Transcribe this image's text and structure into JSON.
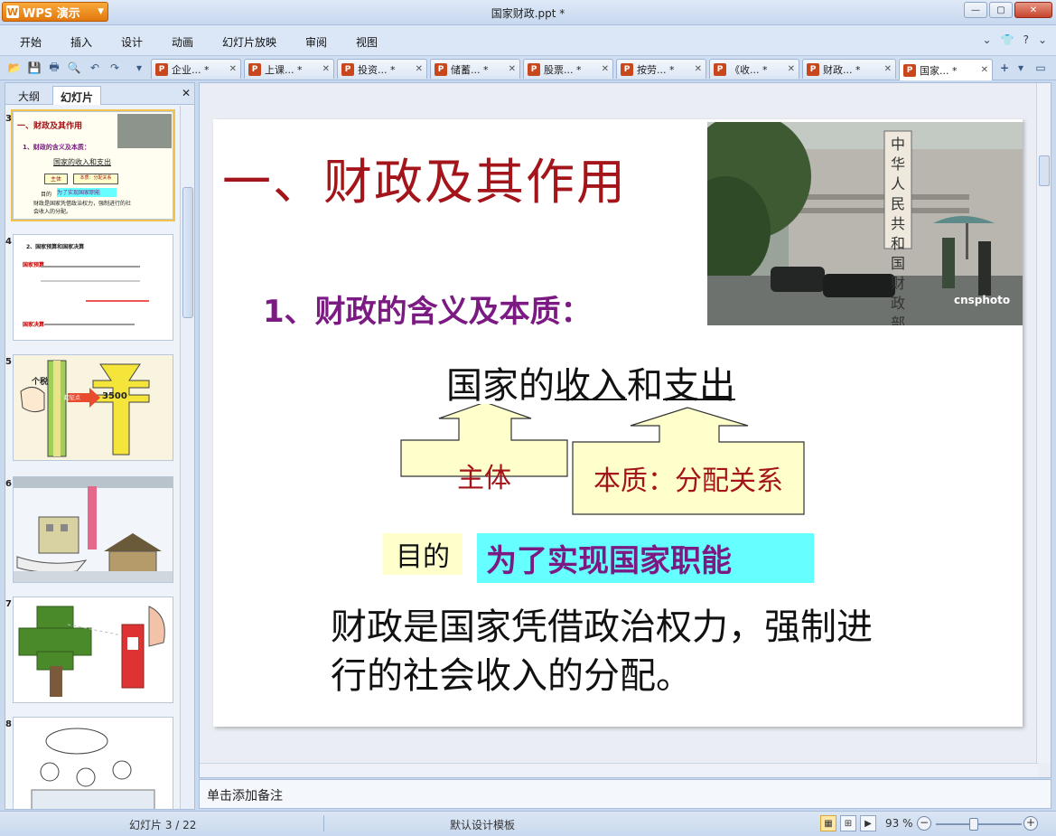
{
  "app": {
    "brand": "WPS 演示",
    "window_title": "国家财政.ppt *"
  },
  "menu": [
    "开始",
    "插入",
    "设计",
    "动画",
    "幻灯片放映",
    "审阅",
    "视图"
  ],
  "tabs": [
    {
      "label": "企业... *"
    },
    {
      "label": "上课... *"
    },
    {
      "label": "投资... *"
    },
    {
      "label": "储蓄... *"
    },
    {
      "label": "股票... *"
    },
    {
      "label": "按劳... *"
    },
    {
      "label": "《收... *"
    },
    {
      "label": "财政... *"
    },
    {
      "label": "国家... *"
    }
  ],
  "left_pane": {
    "tab_outline": "大纲",
    "tab_slides": "幻灯片",
    "thumbs": [
      {
        "num": "3",
        "title": "一、财政及其作用",
        "sub": "1、财政的含义及本质：",
        "t1": "国家的收入和支出",
        "t2": "主体",
        "t3": "本质：分配关系",
        "t4": "目的",
        "t5": "为了实现国家职能",
        "t6": "财政是国家凭借政治权力，强制进行的社会收入的分配。"
      },
      {
        "num": "4",
        "title": "2、国家预算和国家决算",
        "l1": "国家预算",
        "l2": "国家决算"
      },
      {
        "num": "5",
        "t1": "个税",
        "t2": "起征点",
        "t3": "3500"
      },
      {
        "num": "6"
      },
      {
        "num": "7"
      },
      {
        "num": "8"
      }
    ]
  },
  "slide": {
    "title": "一、财政及其作用",
    "subtitle": "1、财政的含义及本质：",
    "line_pre": "国家的",
    "line_income": "收入",
    "line_and": "和",
    "line_expense": "支出",
    "box_subject": "主体",
    "box_essence": "本质：分配关系",
    "purpose_label": "目的",
    "purpose_text": "为了实现国家职能",
    "definition": "财政是国家凭借政治权力，强制进行的社会收入的分配。",
    "photo_sign": "中华人民共和国财政部",
    "photo_credit": "cnsphoto"
  },
  "notes_placeholder": "单击添加备注",
  "status": {
    "slide_info": "幻灯片 3 / 22",
    "theme": "默认设计模板",
    "zoom": "93 %"
  }
}
